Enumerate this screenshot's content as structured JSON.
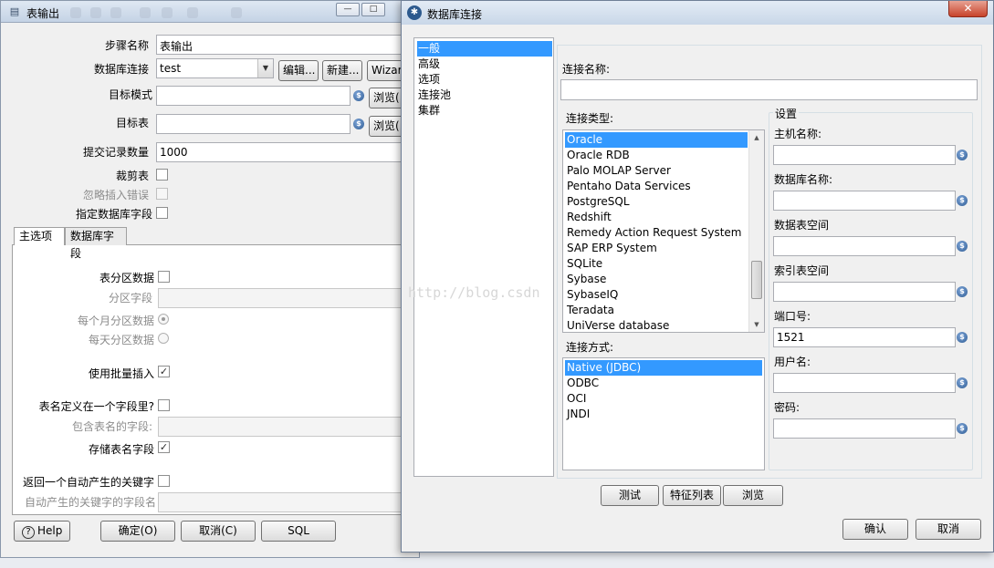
{
  "background_window": {
    "title": "表输出",
    "fields": {
      "step_name_label": "步骤名称",
      "step_name_value": "表输出",
      "db_connection_label": "数据库连接",
      "db_connection_value": "test",
      "edit_button": "编辑...",
      "new_button": "新建...",
      "wizard_button": "Wizar",
      "target_schema_label": "目标模式",
      "browse_label": "浏览(",
      "target_table_label": "目标表",
      "commit_size_label": "提交记录数量",
      "commit_size_value": "1000",
      "truncate_label": "裁剪表",
      "ignore_errors_label": "忽略插入错误",
      "specify_fields_label": "指定数据库字段"
    },
    "tabs": [
      "主选项",
      "数据库字段"
    ],
    "main_options": {
      "partition_label": "表分区数据",
      "partition_field_label": "分区字段",
      "monthly_label": "每个月分区数据",
      "daily_label": "每天分区数据",
      "batch_label": "使用批量插入",
      "table_in_field_label": "表名定义在一个字段里?",
      "table_name_field_label": "包含表名的字段:",
      "store_table_name_label": "存储表名字段",
      "return_key_label": "返回一个自动产生的关键字",
      "key_field_label": "自动产生的关键字的字段名"
    },
    "bottom_buttons": {
      "help": "Help",
      "ok": "确定(O)",
      "cancel": "取消(C)",
      "sql": "SQL"
    }
  },
  "dialog": {
    "title": "数据库连接",
    "close": "✕",
    "nav_items": [
      "一般",
      "高级",
      "选项",
      "连接池",
      "集群"
    ],
    "connection_name_label": "连接名称:",
    "connection_type_label": "连接类型:",
    "connection_types": [
      "Oracle",
      "Oracle RDB",
      "Palo MOLAP Server",
      "Pentaho Data Services",
      "PostgreSQL",
      "Redshift",
      "Remedy Action Request System",
      "SAP ERP System",
      "SQLite",
      "Sybase",
      "SybaseIQ",
      "Teradata",
      "UniVerse database"
    ],
    "access_label": "连接方式:",
    "access_methods": [
      "Native (JDBC)",
      "ODBC",
      "OCI",
      "JNDI"
    ],
    "settings": {
      "title": "设置",
      "host_label": "主机名称:",
      "db_name_label": "数据库名称:",
      "tablespace_label": "数据表空间",
      "index_tablespace_label": "索引表空间",
      "port_label": "端口号:",
      "port_value": "1521",
      "user_label": "用户名:",
      "password_label": "密码:"
    },
    "buttons": {
      "test": "测试",
      "features": "特征列表",
      "explore": "浏览",
      "confirm": "确认",
      "cancel": "取消"
    }
  },
  "watermark": "http://blog.csdn"
}
